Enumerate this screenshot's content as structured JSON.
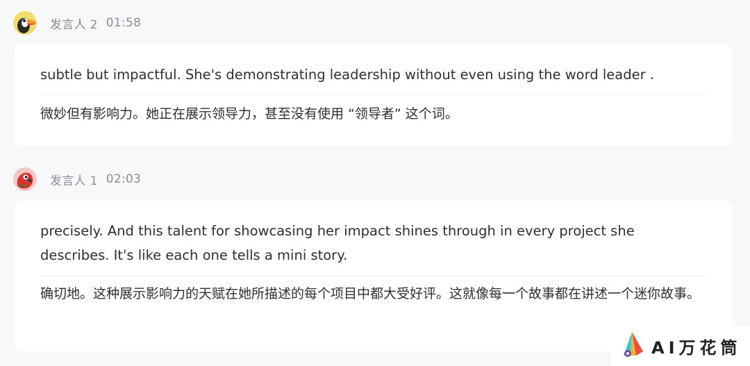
{
  "messages": [
    {
      "speaker": "发言人 2",
      "time": "01:58",
      "avatar_icon": "toucan-icon",
      "avatar_bg": "#f2dc6b",
      "english": "subtle but impactful. She's demonstrating leadership without even using the word leader .",
      "chinese": "微妙但有影响力。她正在展示领导力，甚至没有使用 “领导者” 这个词。"
    },
    {
      "speaker": "发言人 1",
      "time": "02:03",
      "avatar_icon": "parrot-icon",
      "avatar_bg": "#f6c7c5",
      "english": "precisely. And this talent for showcasing her impact shines through in every project she describes. It's like each one tells a mini story.",
      "chinese": "确切地。这种展示影响力的天赋在她所描述的每个项目中都大受好评。这就像每一个故事都在讲述一个迷你故事。"
    }
  ],
  "watermark": {
    "text": "AI万花筒",
    "logo_icon": "kaleidoscope-logo-icon"
  }
}
